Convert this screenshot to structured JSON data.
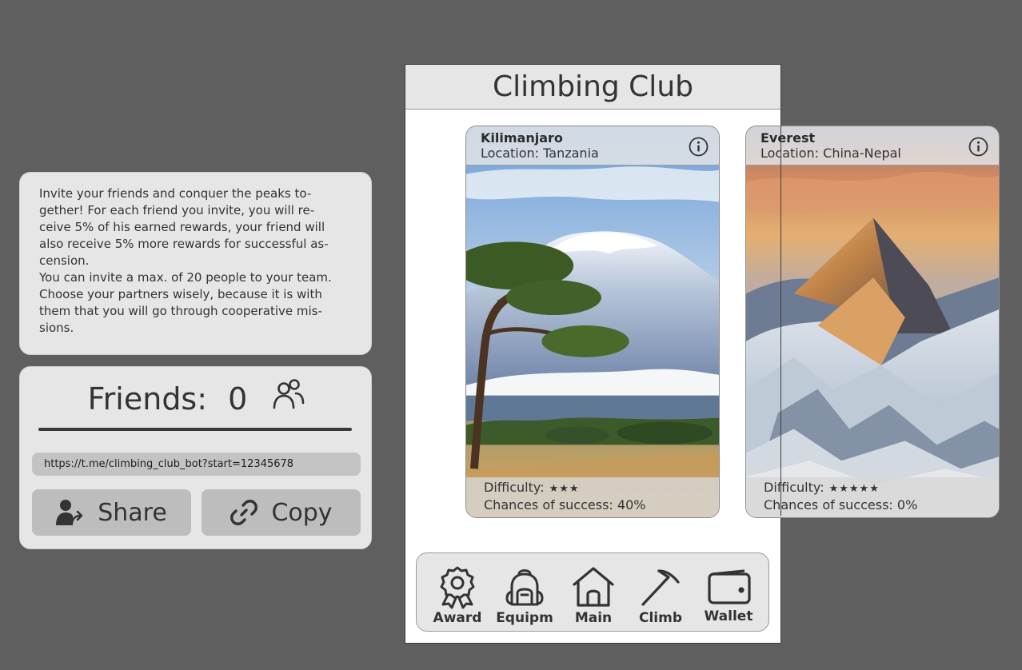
{
  "invite": {
    "lines": [
      "Invite your friends and conquer the peaks to-",
      "gether! For each friend you invite, you will re-",
      "ceive 5% of his earned rewards, your friend will",
      "also receive 5% more rewards for successful as-",
      "cension.",
      "You can invite a max. of 20 people to your team.",
      "Choose your partners wisely, because it is with",
      "them that you will go through cooperative mis-",
      "sions."
    ]
  },
  "friends": {
    "label": "Friends:",
    "count": "0",
    "link": "https://t.me/climbing_club_bot?start=12345678",
    "share_label": "Share",
    "copy_label": "Copy"
  },
  "app": {
    "title": "Climbing Club"
  },
  "cards": [
    {
      "name": "Kilimanjaro",
      "location": "Location: Tanzania",
      "difficulty_label": "Difficulty:",
      "difficulty_stars": "★★★",
      "chances": "Chances of success: 40%"
    },
    {
      "name": "Everest",
      "location": "Location: China-Nepal",
      "difficulty_label": "Difficulty:",
      "difficulty_stars": "★★★★★",
      "chances": "Chances of success: 0%"
    }
  ],
  "nav": [
    {
      "label": "Award",
      "icon": "award-icon"
    },
    {
      "label": "Equipm",
      "icon": "backpack-icon"
    },
    {
      "label": "Main",
      "icon": "home-icon"
    },
    {
      "label": "Climb",
      "icon": "pickaxe-icon"
    },
    {
      "label": "Wallet",
      "icon": "wallet-icon"
    }
  ]
}
